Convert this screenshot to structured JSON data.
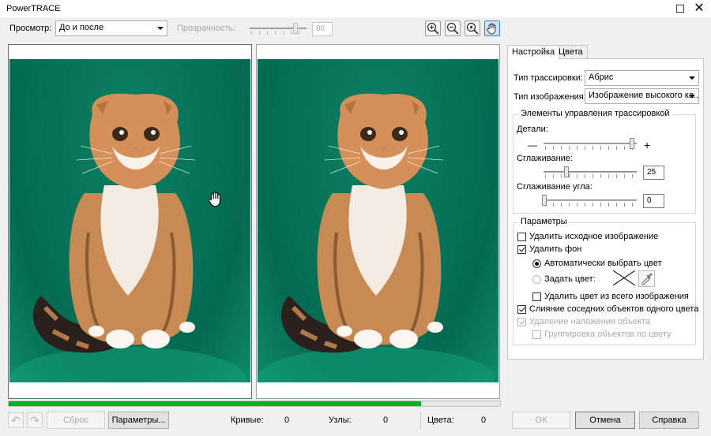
{
  "window": {
    "title": "PowerTRACE",
    "maximize_glyph": "☐",
    "close_glyph": "✕"
  },
  "toolbar": {
    "view_label": "Просмотр:",
    "view_value": "До и после",
    "transparency_label": "Прозрачность:",
    "transparency_value": "80",
    "tools": [
      "zoom-in-icon",
      "zoom-out-icon",
      "zoom-fit-icon",
      "pan-hand-icon"
    ]
  },
  "panel": {
    "tabs": [
      "Настройка",
      "Цвета"
    ],
    "trace_type_label": "Тип трассировки:",
    "trace_type_value": "Абрис",
    "image_type_label": "Тип изображения:",
    "image_type_value": "Изображение высокого ка...",
    "controls_group": "Элементы управления трассировкой",
    "detail_label": "Детали:",
    "detail_minus": "—",
    "detail_plus": "+",
    "smoothing_label": "Сглаживание:",
    "smoothing_value": "25",
    "corner_label": "Сглаживание угла:",
    "corner_value": "0",
    "params_group": "Параметры",
    "options": {
      "delete_original": "Удалить исходное изображение",
      "remove_background": "Удалить фон",
      "auto_color": "Автоматически выбрать цвет",
      "set_color": "Задать цвет:",
      "remove_color_whole": "Удалить цвет из всего изображения",
      "merge_adjacent": "Слияние соседних объектов одного цвета",
      "remove_overlap": "Удаление наложения объекта",
      "group_by_color": "Группировка объектов по цвету"
    }
  },
  "bottom": {
    "reset_label": "Сброс",
    "params_label": "Параметры...",
    "curves_label": "Кривые:",
    "curves_value": "0",
    "nodes_label": "Узлы:",
    "nodes_value": "0",
    "colors_label": "Цвета:",
    "colors_value": "0",
    "ok_label": "ОК",
    "cancel_label": "Отмена",
    "help_label": "Справка",
    "progress_fraction": 0.84
  },
  "colors": {
    "background_green": "#067358",
    "progress_green": "#06b025",
    "active_tool": "#cde3fa"
  }
}
